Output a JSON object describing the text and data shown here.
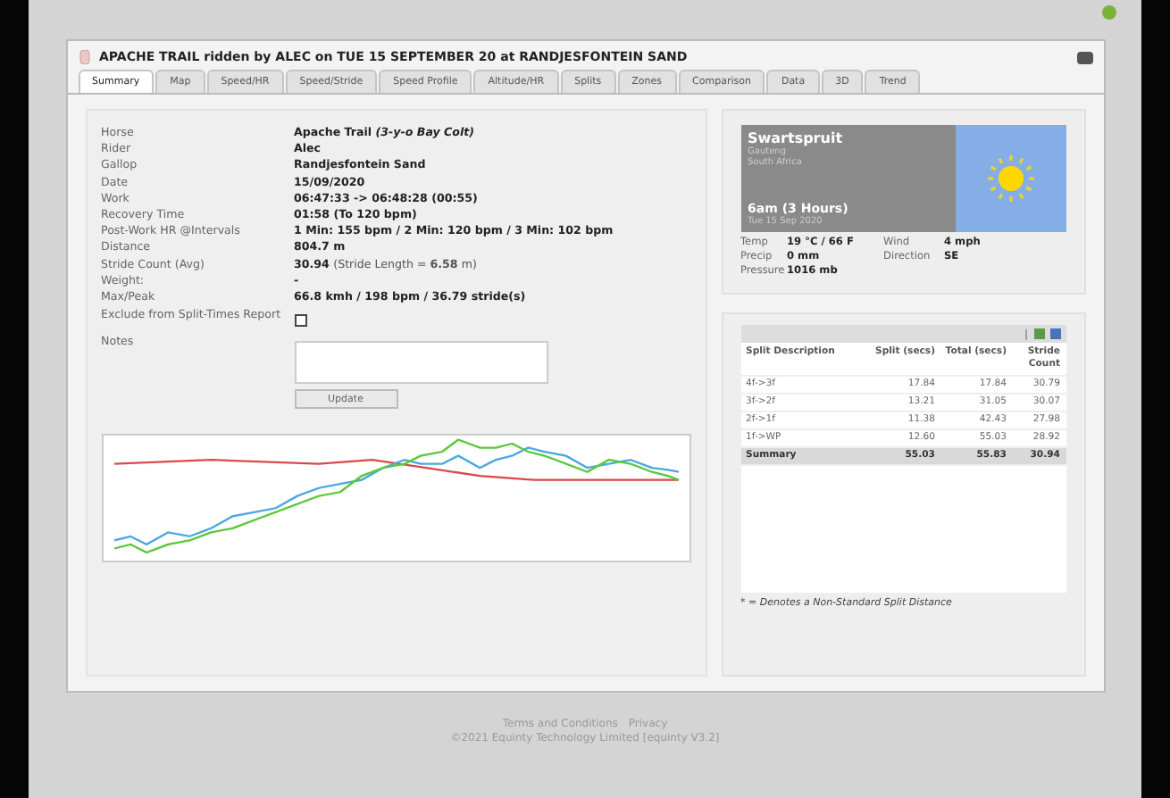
{
  "window": {
    "title": "APACHE TRAIL ridden by ALEC on TUE 15 SEPTEMBER 20 at RANDJESFONTEIN SAND"
  },
  "tabs": [
    {
      "label": "Summary",
      "selected": true
    },
    {
      "label": "Map",
      "selected": false
    },
    {
      "label": "Speed/HR",
      "selected": false
    },
    {
      "label": "Speed/Stride",
      "selected": false
    },
    {
      "label": "Speed Profile",
      "selected": false
    },
    {
      "label": "Altitude/HR",
      "selected": false
    },
    {
      "label": "Splits",
      "selected": false
    },
    {
      "label": "Zones",
      "selected": false
    },
    {
      "label": "Comparison",
      "selected": false
    },
    {
      "label": "Data",
      "selected": false
    },
    {
      "label": "3D",
      "selected": false
    },
    {
      "label": "Trend",
      "selected": false
    }
  ],
  "details": [
    {
      "kind": "text",
      "label": "Horse",
      "value": "Apache Trail",
      "note": "(3-y-o Bay Colt)"
    },
    {
      "kind": "text",
      "label": "Rider",
      "value": "Alec"
    },
    {
      "kind": "text",
      "label": "Gallop",
      "value": "Randjesfontein Sand"
    },
    {
      "kind": "text",
      "label": "Date",
      "value": "15/09/2020"
    },
    {
      "kind": "text",
      "label": "Work",
      "value": "06:47:33 -> 06:48:28 (00:55)"
    },
    {
      "kind": "text",
      "label": "Recovery Time",
      "value": "01:58 (To 120 bpm)"
    },
    {
      "kind": "text",
      "label": "Post-Work HR @Intervals",
      "value": "1 Min: 155 bpm / 2 Min: 120 bpm / 3 Min: 102 bpm"
    },
    {
      "kind": "text",
      "label": "Distance",
      "value": "804.7 m"
    },
    {
      "kind": "text",
      "label": "Stride Count (Avg)",
      "value": "30.94",
      "detail": "(Stride Length = **6.58** m)"
    },
    {
      "kind": "text",
      "label": "Weight:",
      "value": "-"
    },
    {
      "kind": "text",
      "label": "Max/Peak",
      "value": "66.8 kmh / 198 bpm / 36.79 stride(s)"
    },
    {
      "kind": "checkbox",
      "label": "Exclude from Split-Times Report",
      "checked": false
    },
    {
      "kind": "textarea",
      "label": "Notes"
    }
  ],
  "update_button": "Update",
  "weather": {
    "place": "Swartspruit",
    "region": "Gauteng",
    "country": "South Africa",
    "period": "6am (3 Hours)",
    "date": "Tue 15 Sep 2020",
    "readings": [
      {
        "label": "Temp",
        "value": "19 °C / 66 F"
      },
      {
        "label": "Wind",
        "value": "4 mph"
      },
      {
        "label": "Precip",
        "value": "0 mm"
      },
      {
        "label": "Direction",
        "value": "SE"
      },
      {
        "label": "Pressure",
        "value": "1016 mb"
      }
    ]
  },
  "splits": {
    "toolbar_separator": "|",
    "columns": [
      "Split Description",
      "Split (secs)",
      "Total (secs)",
      "Stride Count"
    ],
    "rows": [
      {
        "cells": [
          "4f->3f",
          "17.84",
          "17.84",
          "30.79"
        ],
        "summary": false
      },
      {
        "cells": [
          "3f->2f",
          "13.21",
          "31.05",
          "30.07"
        ],
        "summary": false
      },
      {
        "cells": [
          "2f->1f",
          "11.38",
          "42.43",
          "27.98"
        ],
        "summary": false
      },
      {
        "cells": [
          "1f->WP",
          "12.60",
          "55.03",
          "28.92"
        ],
        "summary": false
      },
      {
        "cells": [
          "Summary",
          "55.03",
          "55.83",
          "30.94"
        ],
        "summary": true
      }
    ],
    "footnote": "* = Denotes a Non-Standard Split Distance"
  },
  "footer": {
    "links": [
      "Terms and Conditions",
      "Privacy"
    ],
    "copyright": "©2021 Equinty Technology Limited [equinty V3.2]"
  }
}
